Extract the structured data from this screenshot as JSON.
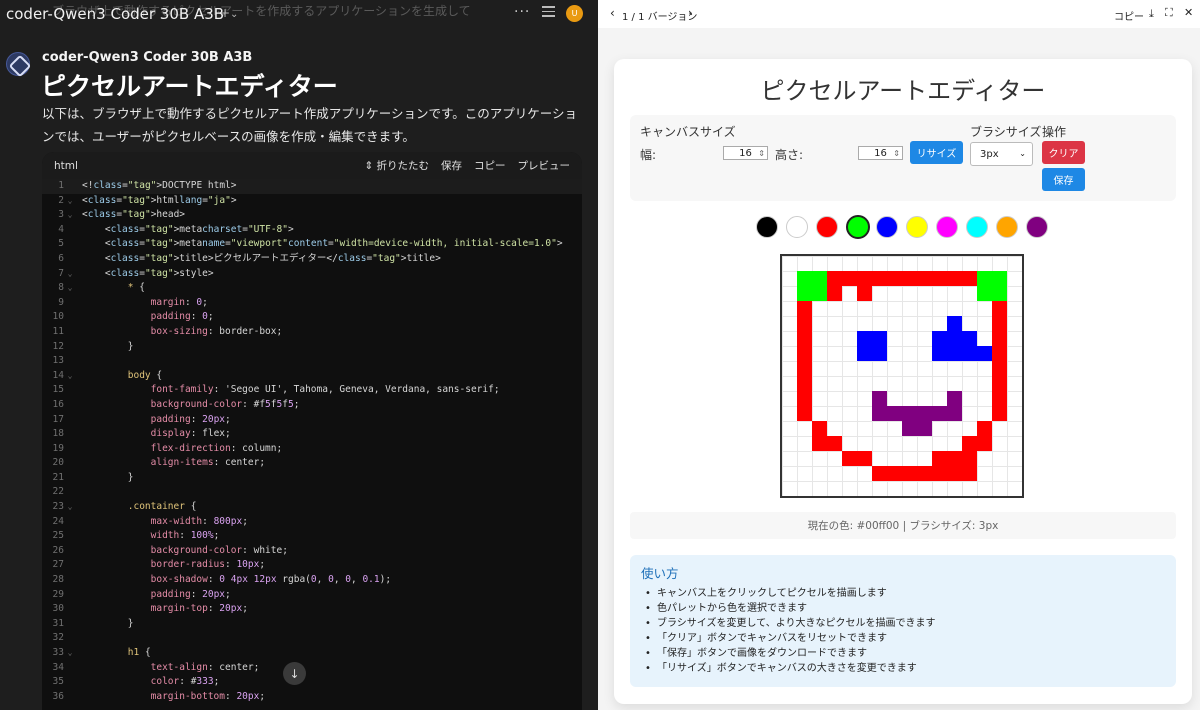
{
  "chat": {
    "ghost_text": "ブラウザ上で動作するピクセルアートを作成するアプリケーションを生成して",
    "model_name": "coder-Qwen3 Coder 30B A3B",
    "bot_name": "coder-Qwen3 Coder 30B A3B",
    "response_title": "ピクセルアートエディター",
    "response_text": "以下は、ブラウザ上で動作するピクセルアート作成アプリケーションです。このアプリケーションでは、ユーザーがピクセルベースの画像を作成・編集できます。",
    "avatar_letter": "U",
    "code": {
      "lang": "html",
      "collapse_label": "折りたたむ",
      "save_label": "保存",
      "copy_label": "コピー",
      "preview_label": "プレビュー",
      "lines": [
        "<!DOCTYPE html>",
        "<html lang=\"ja\">",
        "<head>",
        "    <meta charset=\"UTF-8\">",
        "    <meta name=\"viewport\" content=\"width=device-width, initial-scale=1.0\">",
        "    <title>ピクセルアートエディター</title>",
        "    <style>",
        "        * {",
        "            margin: 0;",
        "            padding: 0;",
        "            box-sizing: border-box;",
        "        }",
        "",
        "        body {",
        "            font-family: 'Segoe UI', Tahoma, Geneva, Verdana, sans-serif;",
        "            background-color: #f5f5f5;",
        "            padding: 20px;",
        "            display: flex;",
        "            flex-direction: column;",
        "            align-items: center;",
        "        }",
        "",
        "        .container {",
        "            max-width: 800px;",
        "            width: 100%;",
        "            background-color: white;",
        "            border-radius: 10px;",
        "            box-shadow: 0 4px 12px rgba(0, 0, 0, 0.1);",
        "            padding: 20px;",
        "            margin-top: 20px;",
        "        }",
        "",
        "        h1 {",
        "            text-align: center;",
        "            color: #333;",
        "            margin-bottom: 20px;"
      ]
    }
  },
  "preview": {
    "page_indicator": "1 / 1 バージョン",
    "copy_label": "コピー",
    "app": {
      "title": "ピクセルアートエディター",
      "canvas_size_label": "キャンバスサイズ",
      "width_label": "幅:",
      "width_value": "16",
      "height_label": "高さ:",
      "height_value": "16",
      "resize_label": "リサイズ",
      "brush_size_label": "ブラシサイズ",
      "brush_value": "3px",
      "actions_label": "操作",
      "clear_label": "クリア",
      "save_label": "保存",
      "palette": [
        "#000000",
        "#ffffff",
        "#ff0000",
        "#00ff00",
        "#0000ff",
        "#ffff00",
        "#ff00ff",
        "#00ffff",
        "#ffa500",
        "#800080"
      ],
      "selected_color": "#00ff00",
      "status_text": "現在の色: #00ff00 | ブラシサイズ: 3px",
      "instructions_title": "使い方",
      "instructions": [
        "キャンバス上をクリックしてピクセルを描画します",
        "色パレットから色を選択できます",
        "ブラシサイズを変更して、より大きなピクセルを描画できます",
        "「クリア」ボタンでキャンバスをリセットできます",
        "「保存」ボタンで画像をダウンロードできます",
        "「リサイズ」ボタンでキャンバスの大きさを変更できます"
      ],
      "grid_cols": 16,
      "grid_rows": 16,
      "pixels": [
        {
          "color": "#ff0000",
          "cells": [
            [
              3,
              1
            ],
            [
              4,
              1
            ],
            [
              5,
              1
            ],
            [
              6,
              1
            ],
            [
              7,
              1
            ],
            [
              8,
              1
            ],
            [
              9,
              1
            ],
            [
              10,
              1
            ],
            [
              11,
              1
            ],
            [
              12,
              1
            ],
            [
              3,
              2
            ],
            [
              5,
              2
            ],
            [
              13,
              2
            ],
            [
              1,
              3
            ],
            [
              14,
              3
            ],
            [
              1,
              4
            ],
            [
              14,
              4
            ],
            [
              1,
              5
            ],
            [
              14,
              5
            ],
            [
              1,
              6
            ],
            [
              14,
              6
            ],
            [
              1,
              7
            ],
            [
              14,
              7
            ],
            [
              1,
              8
            ],
            [
              14,
              8
            ],
            [
              1,
              9
            ],
            [
              14,
              9
            ],
            [
              1,
              10
            ],
            [
              14,
              10
            ],
            [
              2,
              11
            ],
            [
              13,
              11
            ],
            [
              2,
              12
            ],
            [
              3,
              12
            ],
            [
              12,
              12
            ],
            [
              13,
              12
            ],
            [
              4,
              13
            ],
            [
              5,
              13
            ],
            [
              10,
              13
            ],
            [
              11,
              13
            ],
            [
              12,
              13
            ],
            [
              6,
              14
            ],
            [
              7,
              14
            ],
            [
              8,
              14
            ],
            [
              9,
              14
            ],
            [
              10,
              14
            ],
            [
              11,
              14
            ],
            [
              12,
              14
            ]
          ]
        },
        {
          "color": "#00ff00",
          "cells": [
            [
              1,
              1
            ],
            [
              2,
              1
            ],
            [
              1,
              2
            ],
            [
              2,
              2
            ],
            [
              13,
              1
            ],
            [
              14,
              1
            ],
            [
              13,
              2
            ],
            [
              14,
              2
            ]
          ]
        },
        {
          "color": "#0000ff",
          "cells": [
            [
              11,
              4
            ],
            [
              11,
              5
            ],
            [
              12,
              5
            ],
            [
              11,
              6
            ],
            [
              12,
              6
            ],
            [
              13,
              6
            ],
            [
              5,
              5
            ],
            [
              6,
              5
            ],
            [
              5,
              6
            ],
            [
              6,
              6
            ],
            [
              10,
              5
            ],
            [
              10,
              6
            ]
          ]
        },
        {
          "color": "#800080",
          "cells": [
            [
              6,
              9
            ],
            [
              11,
              9
            ],
            [
              6,
              10
            ],
            [
              7,
              10
            ],
            [
              8,
              10
            ],
            [
              9,
              10
            ],
            [
              10,
              10
            ],
            [
              11,
              10
            ],
            [
              8,
              11
            ],
            [
              9,
              11
            ]
          ]
        }
      ]
    }
  }
}
